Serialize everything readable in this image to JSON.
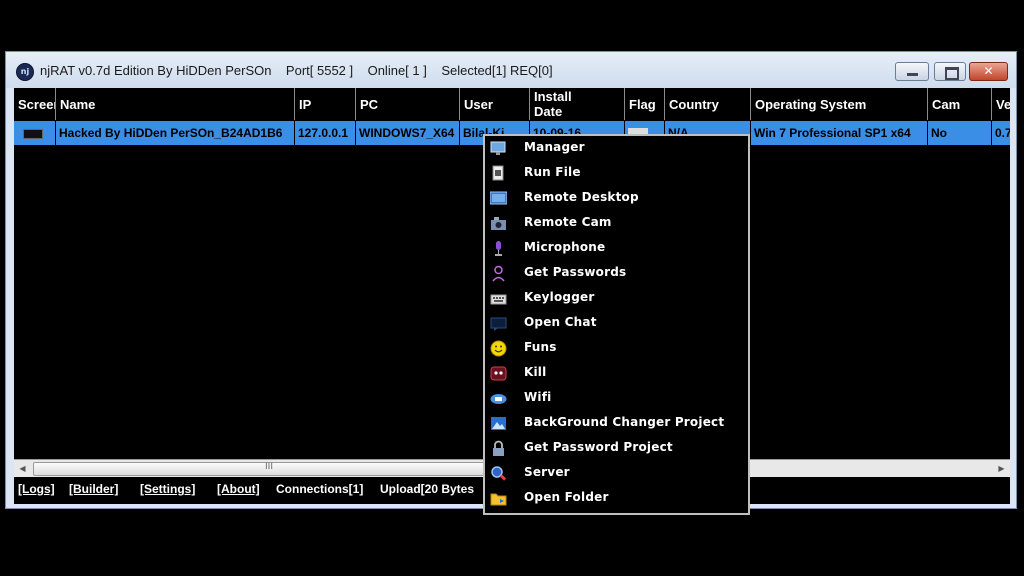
{
  "window": {
    "title": "njRAT v0.7d Edition By HiDDen PerSOn",
    "port": "Port[ 5552 ]",
    "online": "Online[ 1 ]",
    "selected": "Selected[1] REQ[0]",
    "app_icon_text": "nj"
  },
  "table": {
    "headers": [
      "Screen",
      "Name",
      "IP",
      "PC",
      "User",
      "Install Date",
      "Flag",
      "Country",
      "Operating System",
      "Cam",
      "Ver"
    ],
    "row": {
      "name": "Hacked By HiDDen PerSOn_B24AD1B6",
      "ip": "127.0.0.1",
      "pc": "WINDOWS7_X64",
      "user": "Bilal-Ki",
      "install_date": "10-09-16",
      "country": "N/A",
      "os": "Win 7 Professional SP1 x64",
      "cam": "No",
      "ver": "0.7"
    }
  },
  "scrollbar": {
    "left_arrow": "◀",
    "right_arrow": "▶",
    "grip": "III"
  },
  "statusbar": {
    "logs": "[Logs]",
    "builder": "[Builder]",
    "settings": "[Settings]",
    "about": "[About]",
    "connections": "Connections[1]",
    "upload": "Upload[20 Bytes"
  },
  "context_menu": {
    "items": [
      {
        "label": "Manager",
        "icon": "monitor-icon"
      },
      {
        "label": "Run File",
        "icon": "file-icon"
      },
      {
        "label": "Remote Desktop",
        "icon": "desktop-icon"
      },
      {
        "label": "Remote Cam",
        "icon": "camera-icon"
      },
      {
        "label": "Microphone",
        "icon": "microphone-icon"
      },
      {
        "label": "Get Passwords",
        "icon": "user-key-icon"
      },
      {
        "label": "Keylogger",
        "icon": "keyboard-icon"
      },
      {
        "label": "Open Chat",
        "icon": "chat-icon"
      },
      {
        "label": "Funs",
        "icon": "smiley-icon"
      },
      {
        "label": "Kill",
        "icon": "skull-icon"
      },
      {
        "label": "Wifi",
        "icon": "wifi-icon"
      },
      {
        "label": "BackGround Changer Project",
        "icon": "picture-icon"
      },
      {
        "label": "Get Password Project",
        "icon": "lock-icon"
      },
      {
        "label": "Server",
        "icon": "server-icon"
      },
      {
        "label": "Open Folder",
        "icon": "folder-icon"
      }
    ]
  },
  "colors": {
    "row_selected": "#3a8ee6",
    "background": "#000000",
    "titlebar": "#dce6f2"
  }
}
